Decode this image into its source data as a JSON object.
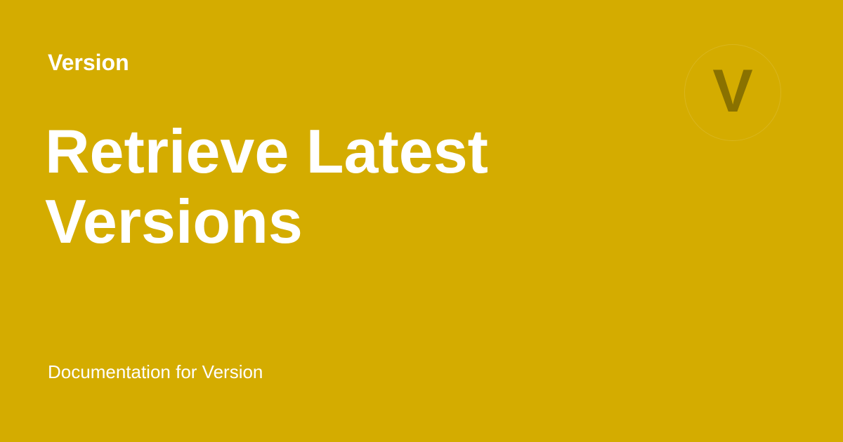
{
  "theme": {
    "background": "#D4AC00",
    "text": "#FFFFFF",
    "badge_letter_color": "#2F2A00"
  },
  "header": {
    "eyebrow": "Version"
  },
  "main": {
    "title": "Retrieve Latest Versions"
  },
  "footer": {
    "subtitle": "Documentation for Version"
  },
  "badge": {
    "letter": "V",
    "icon": "version-letter-icon"
  }
}
